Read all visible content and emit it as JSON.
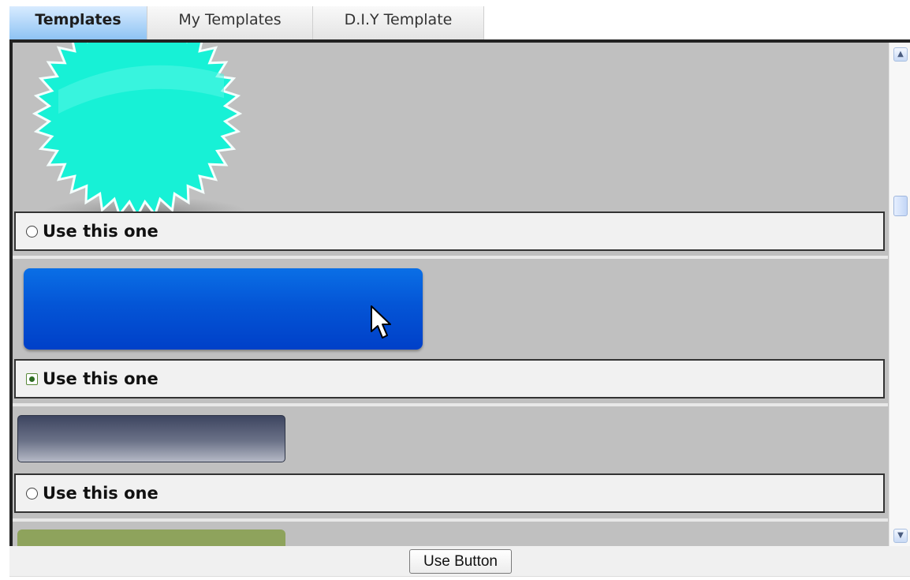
{
  "tabs": [
    {
      "label": "Templates",
      "active": true
    },
    {
      "label": "My Templates",
      "active": false
    },
    {
      "label": "D.I.Y Template",
      "active": false
    }
  ],
  "templates": [
    {
      "preview": "cyan-starburst",
      "option_label": "Use this one",
      "selected": false
    },
    {
      "preview": "blue-rounded-button",
      "option_label": "Use this one",
      "selected": true
    },
    {
      "preview": "slate-gradient-button",
      "option_label": "Use this one",
      "selected": false
    },
    {
      "preview": "olive-button",
      "option_label": null,
      "selected": false
    }
  ],
  "footer": {
    "use_button_label": "Use Button"
  },
  "colors": {
    "active_tab": "#8ec3f3",
    "panel_bg": "#c0c0c0",
    "starburst": "#17f1d6",
    "blue_button": "#0455d6",
    "slate_button": "#5b6279",
    "olive_button": "#8ea35c"
  }
}
